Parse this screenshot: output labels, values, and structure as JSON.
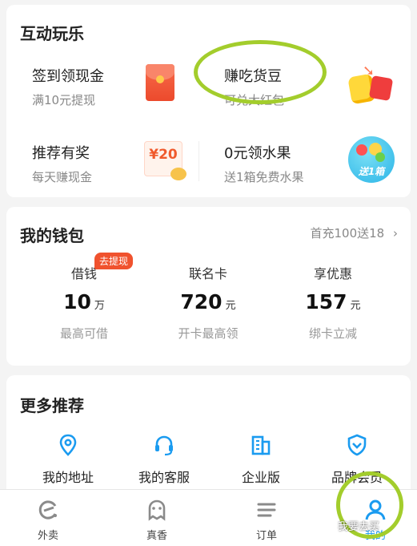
{
  "interactive": {
    "title": "互动玩乐",
    "items": [
      {
        "title": "签到领现金",
        "subtitle": "满10元提现",
        "icon": "red-packet-icon"
      },
      {
        "title": "赚吃货豆",
        "subtitle": "可兑大红包",
        "icon": "beans-icon"
      },
      {
        "title": "推荐有奖",
        "subtitle": "每天赚现金",
        "icon": "coupon-icon",
        "icon_text": "¥20"
      },
      {
        "title": "0元领水果",
        "subtitle": "送1箱免费水果",
        "icon": "fruit-box-icon",
        "icon_text": "送1箱"
      }
    ]
  },
  "wallet": {
    "title": "我的钱包",
    "promo_link": "首充100送18",
    "tag": "去提现",
    "columns": [
      {
        "label": "借钱",
        "value": "10",
        "unit": "万",
        "desc": "最高可借"
      },
      {
        "label": "联名卡",
        "value": "720",
        "unit": "元",
        "desc": "开卡最高领"
      },
      {
        "label": "享优惠",
        "value": "157",
        "unit": "元",
        "desc": "绑卡立减"
      }
    ]
  },
  "more": {
    "title": "更多推荐",
    "items": [
      {
        "label": "我的地址",
        "icon": "location-pin-icon"
      },
      {
        "label": "我的客服",
        "icon": "headset-icon"
      },
      {
        "label": "企业版",
        "icon": "building-icon"
      },
      {
        "label": "品牌会员",
        "icon": "shield-check-icon"
      }
    ]
  },
  "tabs": [
    {
      "label": "外卖",
      "icon": "eleme-logo-icon",
      "active": false
    },
    {
      "label": "真香",
      "icon": "ghost-icon",
      "active": false
    },
    {
      "label": "订单",
      "icon": "list-icon",
      "active": false
    },
    {
      "label": "我的",
      "icon": "profile-icon",
      "active": true
    }
  ],
  "watermark": "我要去买",
  "colors": {
    "accent": "#1a9bf0",
    "highlight_ring": "#a3cd2c",
    "tag": "#f0522e"
  }
}
